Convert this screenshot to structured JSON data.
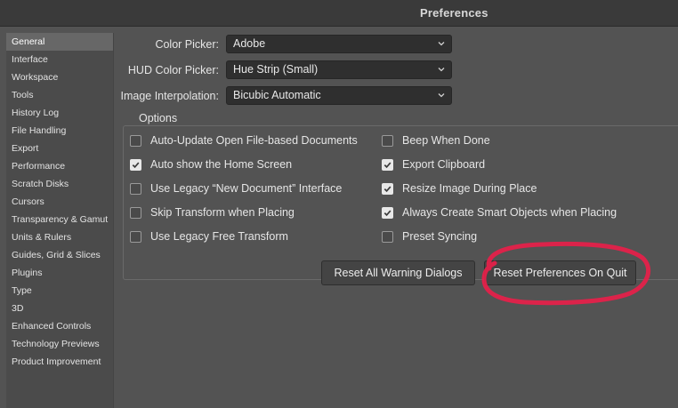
{
  "window": {
    "title": "Preferences"
  },
  "sidebar": {
    "items": [
      {
        "label": "General",
        "selected": true
      },
      {
        "label": "Interface"
      },
      {
        "label": "Workspace"
      },
      {
        "label": "Tools"
      },
      {
        "label": "History Log"
      },
      {
        "label": "File Handling"
      },
      {
        "label": "Export"
      },
      {
        "label": "Performance"
      },
      {
        "label": "Scratch Disks"
      },
      {
        "label": "Cursors"
      },
      {
        "label": "Transparency & Gamut"
      },
      {
        "label": "Units & Rulers"
      },
      {
        "label": "Guides, Grid & Slices"
      },
      {
        "label": "Plugins"
      },
      {
        "label": "Type"
      },
      {
        "label": "3D"
      },
      {
        "label": "Enhanced Controls"
      },
      {
        "label": "Technology Previews"
      },
      {
        "label": "Product Improvement"
      }
    ]
  },
  "fields": {
    "color_picker": {
      "label": "Color Picker:",
      "value": "Adobe"
    },
    "hud_color_picker": {
      "label": "HUD Color Picker:",
      "value": "Hue Strip (Small)"
    },
    "image_interpolation": {
      "label": "Image Interpolation:",
      "value": "Bicubic Automatic"
    }
  },
  "options": {
    "legend": "Options",
    "left": [
      {
        "label": "Auto-Update Open File-based Documents",
        "checked": false
      },
      {
        "label": "Auto show the Home Screen",
        "checked": true
      },
      {
        "label": "Use Legacy “New Document” Interface",
        "checked": false
      },
      {
        "label": "Skip Transform when Placing",
        "checked": false
      },
      {
        "label": "Use Legacy Free Transform",
        "checked": false
      }
    ],
    "right": [
      {
        "label": "Beep When Done",
        "checked": false
      },
      {
        "label": "Export Clipboard",
        "checked": true
      },
      {
        "label": "Resize Image During Place",
        "checked": true
      },
      {
        "label": "Always Create Smart Objects when Placing",
        "checked": true
      },
      {
        "label": "Preset Syncing",
        "checked": false
      }
    ]
  },
  "buttons": {
    "reset_warnings": "Reset All Warning Dialogs",
    "reset_prefs": "Reset Preferences On Quit"
  },
  "colors": {
    "background": "#535353",
    "annotation": "#e8204a"
  },
  "icons": {
    "dropdown": "chevron-down-icon",
    "check": "checkmark-icon"
  }
}
